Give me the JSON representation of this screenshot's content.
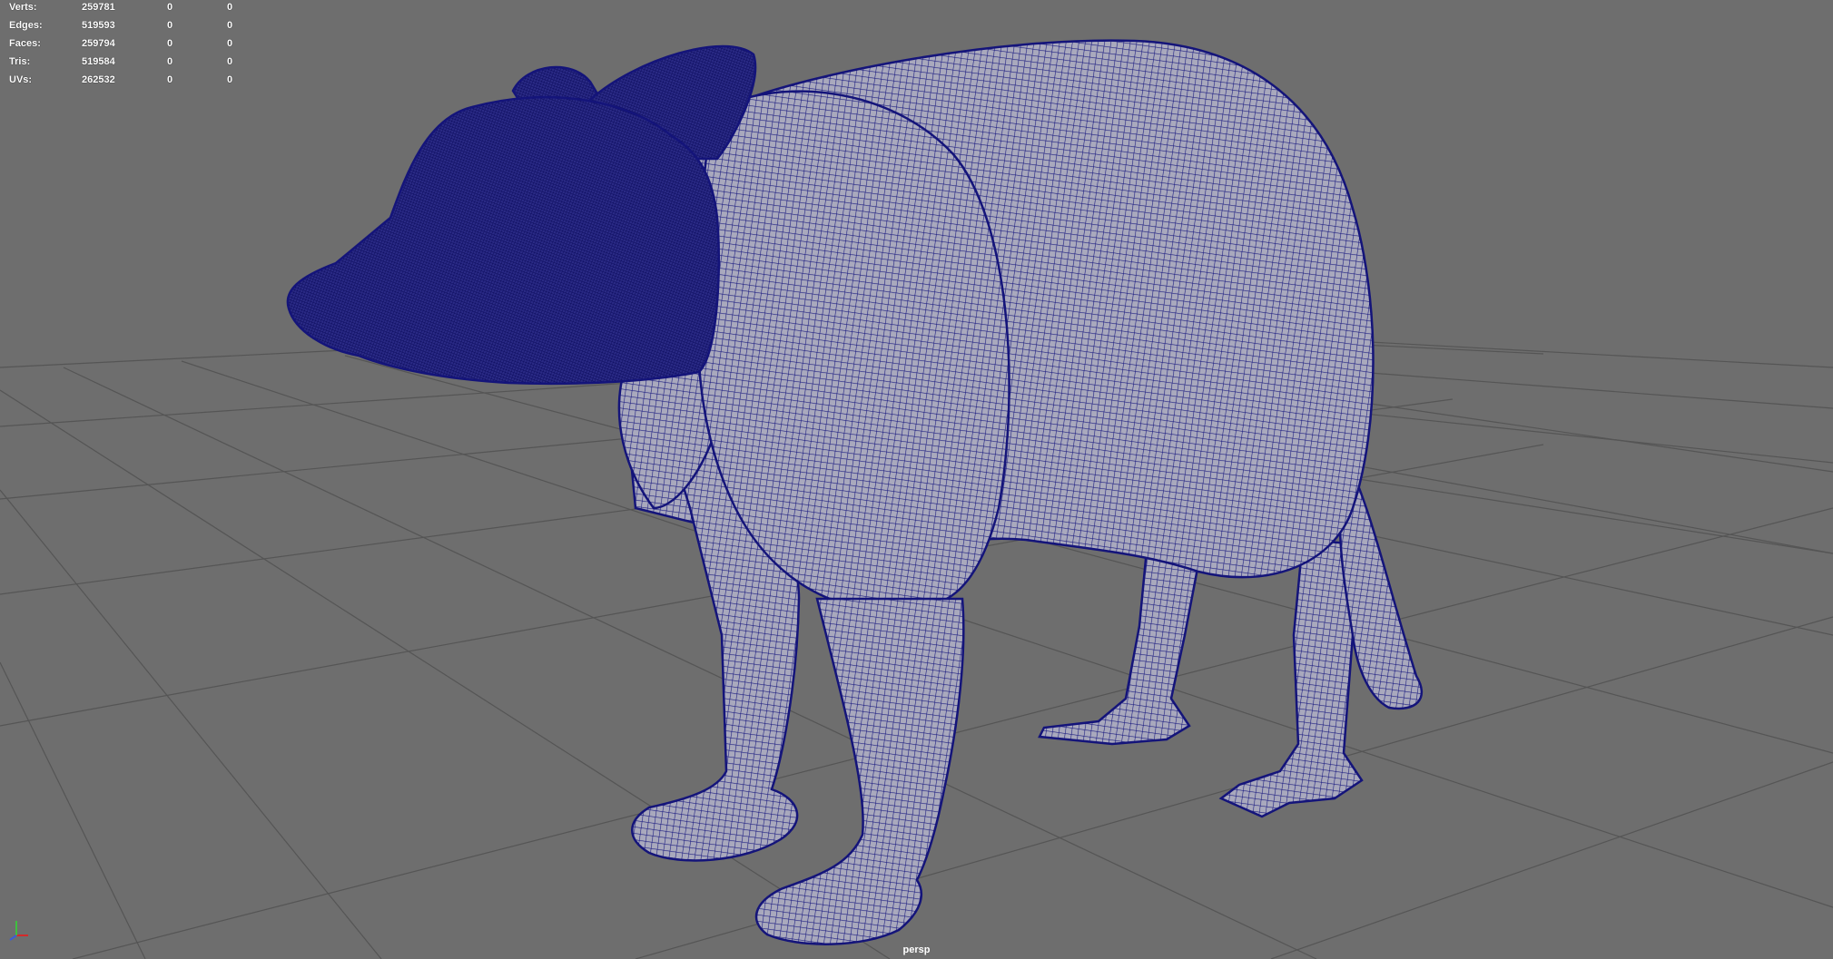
{
  "viewport": {
    "background": "#6e6e6e",
    "camera": "persp",
    "mesh_wire_color": "#14147a",
    "grid_color": "#555555"
  },
  "stats": [
    {
      "label": "Verts:",
      "v0": "259781",
      "v1": "0",
      "v2": "0"
    },
    {
      "label": "Edges:",
      "v0": "519593",
      "v1": "0",
      "v2": "0"
    },
    {
      "label": "Faces:",
      "v0": "259794",
      "v1": "0",
      "v2": "0"
    },
    {
      "label": "Tris:",
      "v0": "519584",
      "v1": "0",
      "v2": "0"
    },
    {
      "label": "UVs:",
      "v0": "262532",
      "v1": "0",
      "v2": "0"
    }
  ],
  "axis_gizmo": {
    "x_color": "#d42a2a",
    "y_color": "#3fbf3f",
    "z_color": "#3c5cd6",
    "icon": "axis-gizmo-icon"
  }
}
